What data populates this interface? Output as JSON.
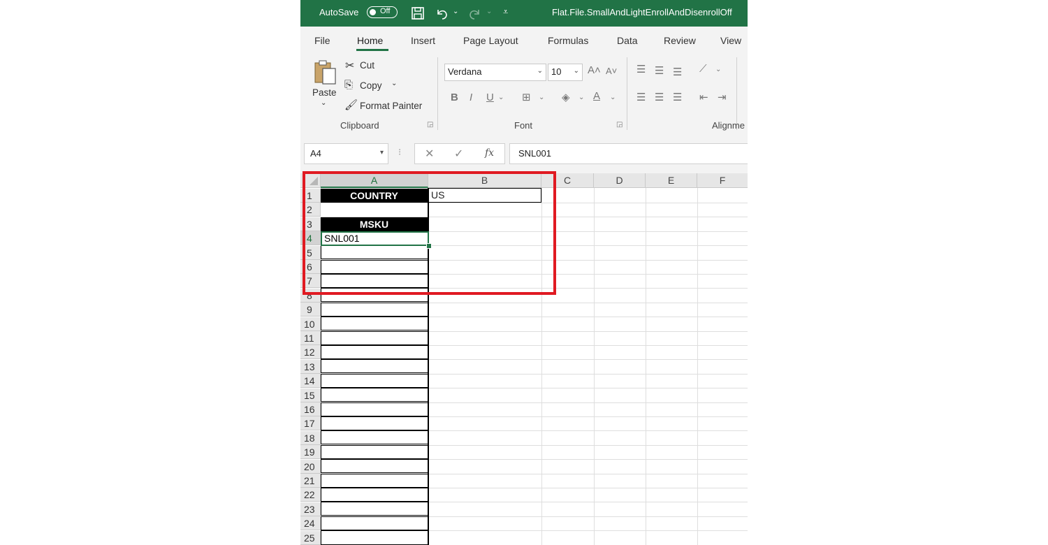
{
  "titlebar": {
    "autosave_label": "AutoSave",
    "autosave_state": "Off",
    "file_title": "Flat.File.SmallAndLightEnrollAndDisenrollOff"
  },
  "tabs": [
    {
      "label": "File"
    },
    {
      "label": "Home"
    },
    {
      "label": "Insert"
    },
    {
      "label": "Page Layout"
    },
    {
      "label": "Formulas"
    },
    {
      "label": "Data"
    },
    {
      "label": "Review"
    },
    {
      "label": "View"
    }
  ],
  "clipboard": {
    "paste": "Paste",
    "cut": "Cut",
    "copy": "Copy",
    "format_painter": "Format Painter",
    "group": "Clipboard"
  },
  "font": {
    "name": "Verdana",
    "size": "10",
    "group": "Font"
  },
  "alignment": {
    "group": "Alignme"
  },
  "formula_bar": {
    "name_box": "A4",
    "content": "SNL001"
  },
  "columns": [
    "A",
    "B",
    "C",
    "D",
    "E",
    "F"
  ],
  "rows": [
    "1",
    "2",
    "3",
    "4",
    "5",
    "6",
    "7",
    "8",
    "9",
    "10",
    "11",
    "12",
    "13",
    "14",
    "15",
    "16",
    "17",
    "18",
    "19",
    "20",
    "21",
    "22",
    "23",
    "24",
    "25"
  ],
  "cells": {
    "A1": "COUNTRY",
    "B1": "US",
    "A3": "MSKU",
    "A4": "SNL001"
  },
  "colors": {
    "excel_green": "#217346",
    "highlight_red": "#e01a22"
  }
}
